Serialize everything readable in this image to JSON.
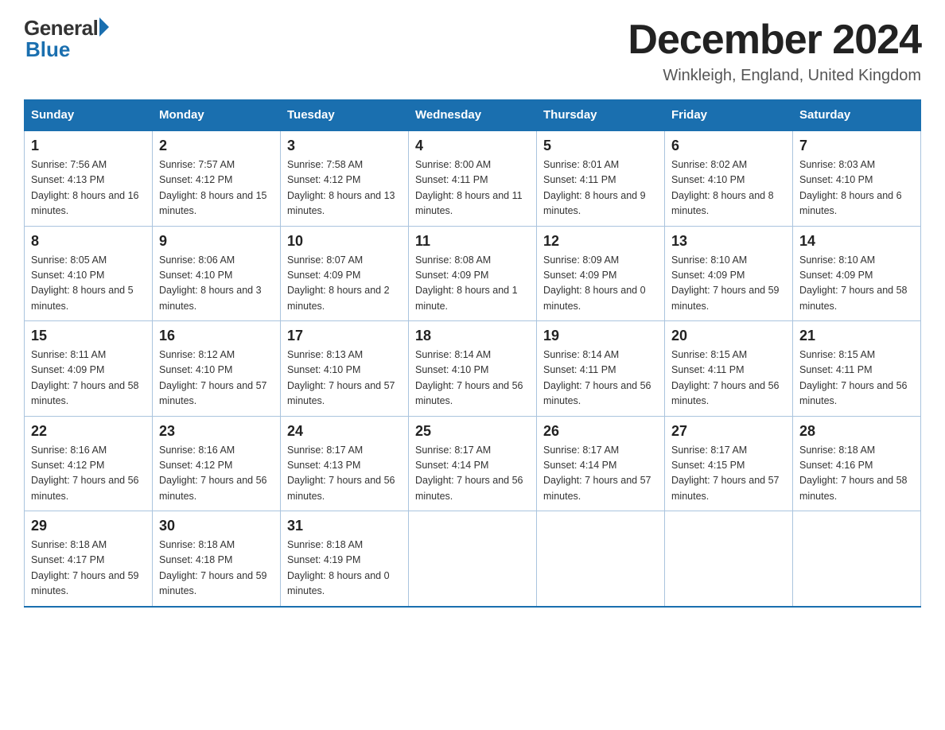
{
  "header": {
    "logo_general": "General",
    "logo_blue": "Blue",
    "title": "December 2024",
    "location": "Winkleigh, England, United Kingdom"
  },
  "days_of_week": [
    "Sunday",
    "Monday",
    "Tuesday",
    "Wednesday",
    "Thursday",
    "Friday",
    "Saturday"
  ],
  "weeks": [
    [
      {
        "num": "1",
        "sunrise": "7:56 AM",
        "sunset": "4:13 PM",
        "daylight": "8 hours and 16 minutes."
      },
      {
        "num": "2",
        "sunrise": "7:57 AM",
        "sunset": "4:12 PM",
        "daylight": "8 hours and 15 minutes."
      },
      {
        "num": "3",
        "sunrise": "7:58 AM",
        "sunset": "4:12 PM",
        "daylight": "8 hours and 13 minutes."
      },
      {
        "num": "4",
        "sunrise": "8:00 AM",
        "sunset": "4:11 PM",
        "daylight": "8 hours and 11 minutes."
      },
      {
        "num": "5",
        "sunrise": "8:01 AM",
        "sunset": "4:11 PM",
        "daylight": "8 hours and 9 minutes."
      },
      {
        "num": "6",
        "sunrise": "8:02 AM",
        "sunset": "4:10 PM",
        "daylight": "8 hours and 8 minutes."
      },
      {
        "num": "7",
        "sunrise": "8:03 AM",
        "sunset": "4:10 PM",
        "daylight": "8 hours and 6 minutes."
      }
    ],
    [
      {
        "num": "8",
        "sunrise": "8:05 AM",
        "sunset": "4:10 PM",
        "daylight": "8 hours and 5 minutes."
      },
      {
        "num": "9",
        "sunrise": "8:06 AM",
        "sunset": "4:10 PM",
        "daylight": "8 hours and 3 minutes."
      },
      {
        "num": "10",
        "sunrise": "8:07 AM",
        "sunset": "4:09 PM",
        "daylight": "8 hours and 2 minutes."
      },
      {
        "num": "11",
        "sunrise": "8:08 AM",
        "sunset": "4:09 PM",
        "daylight": "8 hours and 1 minute."
      },
      {
        "num": "12",
        "sunrise": "8:09 AM",
        "sunset": "4:09 PM",
        "daylight": "8 hours and 0 minutes."
      },
      {
        "num": "13",
        "sunrise": "8:10 AM",
        "sunset": "4:09 PM",
        "daylight": "7 hours and 59 minutes."
      },
      {
        "num": "14",
        "sunrise": "8:10 AM",
        "sunset": "4:09 PM",
        "daylight": "7 hours and 58 minutes."
      }
    ],
    [
      {
        "num": "15",
        "sunrise": "8:11 AM",
        "sunset": "4:09 PM",
        "daylight": "7 hours and 58 minutes."
      },
      {
        "num": "16",
        "sunrise": "8:12 AM",
        "sunset": "4:10 PM",
        "daylight": "7 hours and 57 minutes."
      },
      {
        "num": "17",
        "sunrise": "8:13 AM",
        "sunset": "4:10 PM",
        "daylight": "7 hours and 57 minutes."
      },
      {
        "num": "18",
        "sunrise": "8:14 AM",
        "sunset": "4:10 PM",
        "daylight": "7 hours and 56 minutes."
      },
      {
        "num": "19",
        "sunrise": "8:14 AM",
        "sunset": "4:11 PM",
        "daylight": "7 hours and 56 minutes."
      },
      {
        "num": "20",
        "sunrise": "8:15 AM",
        "sunset": "4:11 PM",
        "daylight": "7 hours and 56 minutes."
      },
      {
        "num": "21",
        "sunrise": "8:15 AM",
        "sunset": "4:11 PM",
        "daylight": "7 hours and 56 minutes."
      }
    ],
    [
      {
        "num": "22",
        "sunrise": "8:16 AM",
        "sunset": "4:12 PM",
        "daylight": "7 hours and 56 minutes."
      },
      {
        "num": "23",
        "sunrise": "8:16 AM",
        "sunset": "4:12 PM",
        "daylight": "7 hours and 56 minutes."
      },
      {
        "num": "24",
        "sunrise": "8:17 AM",
        "sunset": "4:13 PM",
        "daylight": "7 hours and 56 minutes."
      },
      {
        "num": "25",
        "sunrise": "8:17 AM",
        "sunset": "4:14 PM",
        "daylight": "7 hours and 56 minutes."
      },
      {
        "num": "26",
        "sunrise": "8:17 AM",
        "sunset": "4:14 PM",
        "daylight": "7 hours and 57 minutes."
      },
      {
        "num": "27",
        "sunrise": "8:17 AM",
        "sunset": "4:15 PM",
        "daylight": "7 hours and 57 minutes."
      },
      {
        "num": "28",
        "sunrise": "8:18 AM",
        "sunset": "4:16 PM",
        "daylight": "7 hours and 58 minutes."
      }
    ],
    [
      {
        "num": "29",
        "sunrise": "8:18 AM",
        "sunset": "4:17 PM",
        "daylight": "7 hours and 59 minutes."
      },
      {
        "num": "30",
        "sunrise": "8:18 AM",
        "sunset": "4:18 PM",
        "daylight": "7 hours and 59 minutes."
      },
      {
        "num": "31",
        "sunrise": "8:18 AM",
        "sunset": "4:19 PM",
        "daylight": "8 hours and 0 minutes."
      },
      null,
      null,
      null,
      null
    ]
  ]
}
